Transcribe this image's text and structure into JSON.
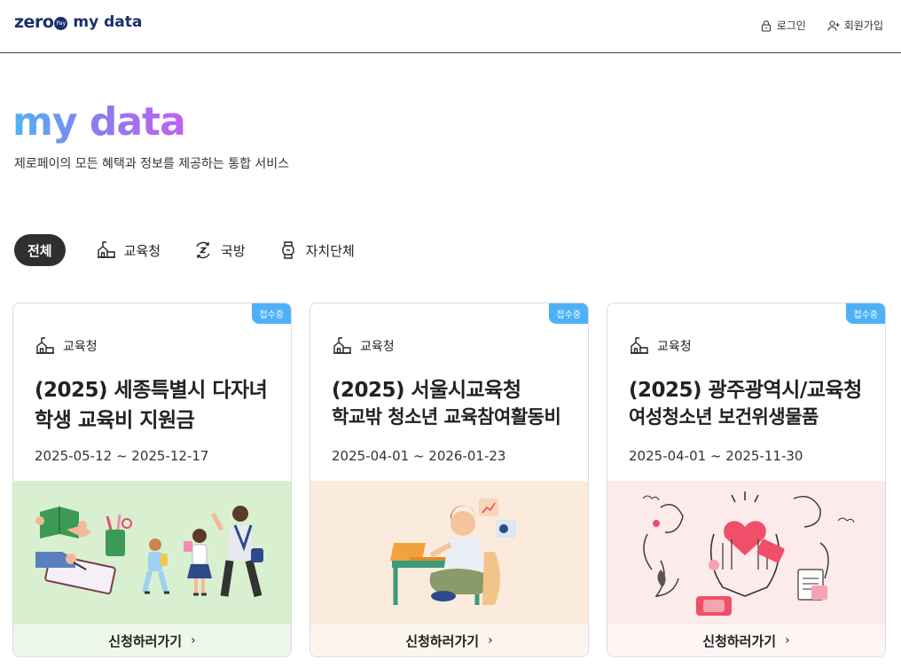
{
  "header": {
    "logo_text": "zero",
    "logo_badge": "Pay",
    "logo_sub": "my data",
    "login_label": "로그인",
    "signup_label": "회원가입"
  },
  "hero": {
    "title": "my data",
    "subtitle": "제로페이의 모든 혜택과 정보를 제공하는 통합 서비스"
  },
  "tabs": [
    {
      "label": "전체",
      "active": true
    },
    {
      "label": "교육청",
      "icon": "school-icon"
    },
    {
      "label": "국방",
      "icon": "defense-icon"
    },
    {
      "label": "자치단체",
      "icon": "local-gov-icon"
    }
  ],
  "cards": [
    {
      "badge": "접수중",
      "category": "교육청",
      "title_line1": "(2025) 세종특별시 다자녀",
      "title_line2": "학생 교육비 지원금",
      "date": "2025-05-12 ~ 2025-12-17",
      "cta": "신청하러가기",
      "illust_bg": "#d8f0cf",
      "footer_bg": "#eef8ea"
    },
    {
      "badge": "접수중",
      "category": "교육청",
      "title_line1": "(2025) 서울시교육청",
      "title_line2": "학교밖 청소년 교육참여활동비",
      "date": "2025-04-01 ~ 2026-01-23",
      "cta": "신청하러가기",
      "illust_bg": "#faebdc",
      "footer_bg": "#fcf5ee"
    },
    {
      "badge": "접수중",
      "category": "교육청",
      "title_line1": "(2025) 광주광역시/교육청",
      "title_line2": "여성청소년 보건위생물품",
      "date": "2025-04-01 ~ 2025-11-30",
      "cta": "신청하러가기",
      "illust_bg": "#fdeaea",
      "footer_bg": "#fef5f5"
    }
  ],
  "colors": {
    "badge": "#4db1f7",
    "brand": "#1d2f6b",
    "active_tab": "#2f2f2f"
  }
}
